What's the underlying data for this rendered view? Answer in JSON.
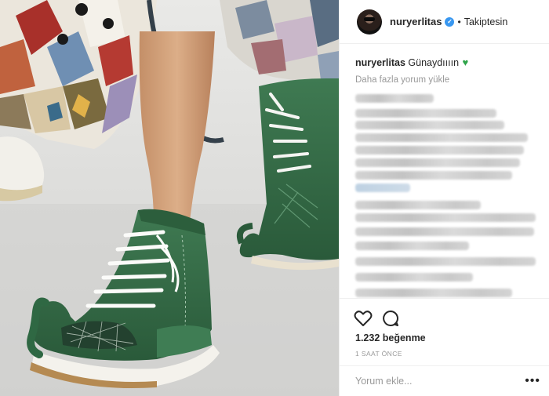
{
  "post": {
    "username": "nuryerlitas",
    "verified_badge": "✓",
    "separator": "•",
    "follow_status": "Takiptesin",
    "caption_user": "nuryerlitas",
    "caption_text": "Günaydıııın",
    "caption_emoji": "♥",
    "load_more": "Daha fazla yorum yükle",
    "likes": "1.232 beğenme",
    "time_ago": "1 SAAT ÖNCE",
    "comment_placeholder": "Yorum ekle...",
    "more_options": "•••"
  },
  "icons": {
    "like": "heart-outline-icon",
    "comment": "comment-bubble-icon",
    "verified": "verified-badge-icon",
    "emoji": "green-heart-icon"
  },
  "colors": {
    "accent_blue": "#3897f0",
    "heart_green": "#2fa44a",
    "muted_text": "#999999",
    "border": "#efefef"
  }
}
